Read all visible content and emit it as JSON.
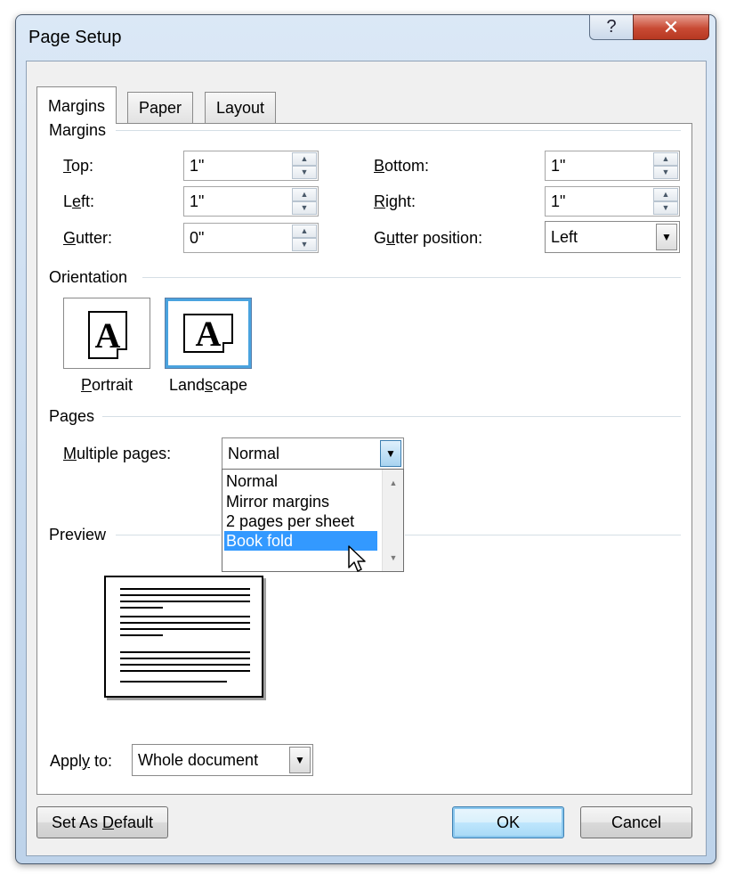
{
  "window": {
    "title": "Page Setup",
    "help_glyph": "?",
    "close_glyph": "✕"
  },
  "tabs": [
    {
      "label": "Margins",
      "active": true
    },
    {
      "label": "Paper",
      "active": false
    },
    {
      "label": "Layout",
      "active": false
    }
  ],
  "margins_group": {
    "label": "Margins",
    "top": {
      "label_u": "T",
      "label_rest": "op:",
      "value": "1\""
    },
    "left": {
      "label_pre": "L",
      "label_u": "e",
      "label_rest": "ft:",
      "value": "1\""
    },
    "gutter": {
      "label_u": "G",
      "label_rest": "utter:",
      "value": "0\""
    },
    "bottom": {
      "label_u": "B",
      "label_rest": "ottom:",
      "value": "1\""
    },
    "right": {
      "label_u": "R",
      "label_rest": "ight:",
      "value": "1\""
    },
    "gutter_position": {
      "label_pre": "G",
      "label_u": "u",
      "label_rest": "tter position:",
      "value": "Left"
    }
  },
  "orientation_group": {
    "label": "Orientation",
    "portrait": {
      "caption_u": "P",
      "caption_rest": "ortrait",
      "glyph": "A",
      "selected": false
    },
    "landscape": {
      "caption_pre": "Land",
      "caption_u": "s",
      "caption_rest": "cape",
      "glyph": "A",
      "selected": true
    }
  },
  "pages_group": {
    "label": "Pages",
    "multiple_pages": {
      "label_u": "M",
      "label_rest": "ultiple pages:",
      "value": "Normal",
      "options": [
        "Normal",
        "Mirror margins",
        "2 pages per sheet",
        "Book fold"
      ],
      "highlighted": "Book fold"
    }
  },
  "preview_group": {
    "label": "Preview"
  },
  "apply_to": {
    "label_pre": "Appl",
    "label_u": "y",
    "label_rest": " to:",
    "value": "Whole document"
  },
  "buttons": {
    "set_default_pre": "Set As ",
    "set_default_u": "D",
    "set_default_rest": "efault",
    "ok": "OK",
    "cancel": "Cancel"
  },
  "colors": {
    "highlight": "#3399ff",
    "title_bar": "#c6d9ee",
    "close_button": "#c84a34",
    "selected_border": "#4aa3df"
  }
}
